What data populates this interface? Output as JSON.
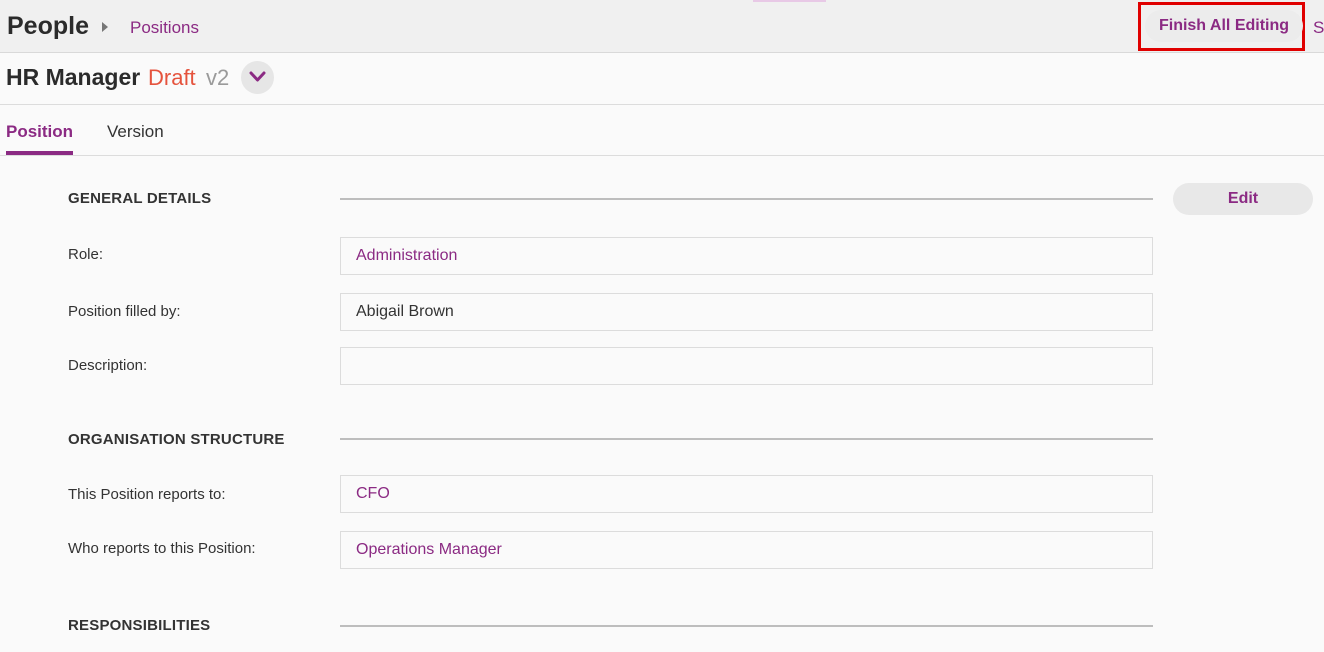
{
  "breadcrumb": {
    "app_title": "People",
    "current": "Positions",
    "right_cut_text": "S"
  },
  "header": {
    "title": "HR Manager",
    "status": "Draft",
    "version": "v2",
    "finish_label": "Finish All Editing"
  },
  "tabs": [
    {
      "label": "Position",
      "active": true
    },
    {
      "label": "Version",
      "active": false
    }
  ],
  "sections": {
    "general": {
      "title": "GENERAL DETAILS",
      "edit_label": "Edit",
      "fields": [
        {
          "label": "Role:",
          "value": "Administration"
        },
        {
          "label": "Position filled by:",
          "value": "Abigail Brown"
        },
        {
          "label": "Description:",
          "value": ""
        }
      ]
    },
    "org": {
      "title": "ORGANISATION STRUCTURE",
      "fields": [
        {
          "label": "This Position reports to:",
          "value": "CFO"
        },
        {
          "label": "Who reports to this Position:",
          "value": "Operations Manager"
        }
      ]
    },
    "responsibilities": {
      "title": "RESPONSIBILITIES"
    }
  },
  "colors": {
    "brand": "#8b2a83",
    "draft": "#e5533d",
    "highlight_box": "#e00000"
  },
  "icons": {
    "breadcrumb_separator": "caret-right-icon",
    "version_dropdown": "chevron-down-icon"
  }
}
